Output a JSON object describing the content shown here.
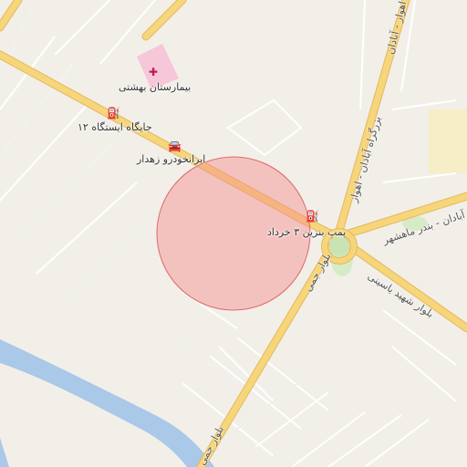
{
  "map": {
    "colors": {
      "background": "#f2efe9",
      "major_road": "#f7d57a",
      "major_road_casing": "#e3b95c",
      "minor_road": "#ffffff",
      "minor_road_casing": "#d6d2cb",
      "river": "#aac8e8",
      "hospital": "#f6c6d9",
      "circle_fill": "#f48c8c",
      "circle_stroke": "#e06a6a",
      "park": "#d7ebc7",
      "yellow_area": "#f5eec6"
    },
    "pois": [
      {
        "id": "hospital",
        "label": "بیمارستان بهشتی",
        "icon": "hospital-cross-icon",
        "glyph": "✚"
      },
      {
        "id": "gas12",
        "label": "جایگاه ایستگاه ۱۲",
        "icon": "fuel-pump-icon",
        "glyph": "⛽"
      },
      {
        "id": "car",
        "label": "ایرانخودرو زهدار",
        "icon": "car-icon",
        "glyph": "🚘"
      },
      {
        "id": "gas3",
        "label": "پمپ بنزین ۳ خرداد",
        "icon": "fuel-pump-icon",
        "glyph": "⛽"
      }
    ],
    "road_labels": [
      "بزرگراه آبادان - اهواز",
      "اهواز - آبادان",
      "آبادان - بندر ماهشهر",
      "بلوار شهید یاسینی",
      "بلوار جمی",
      "بلوار جمی"
    ]
  }
}
